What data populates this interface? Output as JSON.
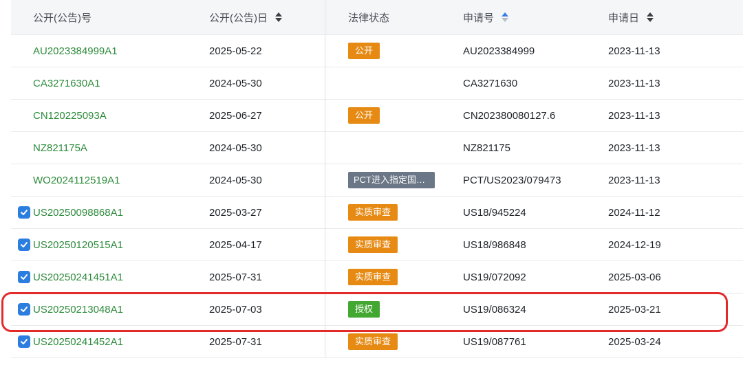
{
  "table": {
    "columns": {
      "pub_no": "公开(公告)号",
      "pub_date": "公开(公告)日",
      "legal_status": "法律状态",
      "app_no": "申请号",
      "app_date": "申请日"
    },
    "rows": [
      {
        "pub_no": "AU2023384999A1",
        "pub_date": "2025-05-22",
        "status": "公开",
        "status_color": "#e68a13",
        "app_no": "AU2023384999",
        "app_date": "2023-11-13",
        "checked": false
      },
      {
        "pub_no": "CA3271630A1",
        "pub_date": "2024-05-30",
        "status": "",
        "status_color": "",
        "app_no": "CA3271630",
        "app_date": "2023-11-13",
        "checked": false
      },
      {
        "pub_no": "CN120225093A",
        "pub_date": "2025-06-27",
        "status": "公开",
        "status_color": "#e68a13",
        "app_no": "CN202380080127.6",
        "app_date": "2023-11-13",
        "checked": false
      },
      {
        "pub_no": "NZ821175A",
        "pub_date": "2024-05-30",
        "status": "",
        "status_color": "",
        "app_no": "NZ821175",
        "app_date": "2023-11-13",
        "checked": false
      },
      {
        "pub_no": "WO2024112519A1",
        "pub_date": "2024-05-30",
        "status": "PCT进入指定国…",
        "status_color": "#6b7686",
        "app_no": "PCT/US2023/079473",
        "app_date": "2023-11-13",
        "checked": false
      },
      {
        "pub_no": "US20250098868A1",
        "pub_date": "2025-03-27",
        "status": "实质审查",
        "status_color": "#e68a13",
        "app_no": "US18/945224",
        "app_date": "2024-11-12",
        "checked": true
      },
      {
        "pub_no": "US20250120515A1",
        "pub_date": "2025-04-17",
        "status": "实质审查",
        "status_color": "#e68a13",
        "app_no": "US18/986848",
        "app_date": "2024-12-19",
        "checked": true
      },
      {
        "pub_no": "US20250241451A1",
        "pub_date": "2025-07-31",
        "status": "实质审查",
        "status_color": "#e68a13",
        "app_no": "US19/072092",
        "app_date": "2025-03-06",
        "checked": true
      },
      {
        "pub_no": "US20250213048A1",
        "pub_date": "2025-07-03",
        "status": "授权",
        "status_color": "#42a832",
        "app_no": "US19/086324",
        "app_date": "2025-03-21",
        "checked": true
      },
      {
        "pub_no": "US20250241452A1",
        "pub_date": "2025-07-31",
        "status": "实质审查",
        "status_color": "#e68a13",
        "app_no": "US19/087761",
        "app_date": "2025-03-24",
        "checked": true
      }
    ]
  },
  "icons": {
    "sort": "sort-icon",
    "checkbox": "checkbox-checked-icon"
  },
  "colors": {
    "link": "#2e8b3c",
    "highlight": "#e32b2b",
    "checkbox": "#2b7de0"
  }
}
